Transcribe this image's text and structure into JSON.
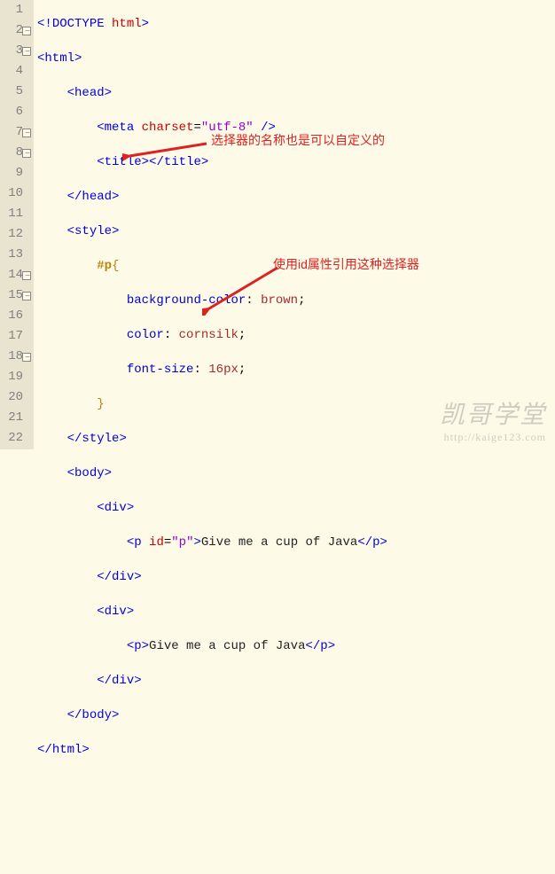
{
  "watermark": {
    "text": "凯哥学堂",
    "url": "http://kaige123.com"
  },
  "annotations": {
    "top": "选择器的名称也是可以自定义的",
    "bottom": "使用id属性引用这种选择器"
  },
  "gutter": [
    "1",
    "2",
    "3",
    "4",
    "5",
    "6",
    "7",
    "8",
    "9",
    "10",
    "11",
    "12",
    "13",
    "14",
    "15",
    "16",
    "17",
    "18",
    "19",
    "20",
    "21",
    "22"
  ],
  "code": {
    "l1": {
      "t1": "<!",
      "t2": "DOCTYPE",
      "sp": " ",
      "t3": "html",
      "t4": ">"
    },
    "l2": {
      "t1": "<",
      "t2": "html",
      "t3": ">"
    },
    "l3": {
      "pad": "    ",
      "t1": "<",
      "t2": "head",
      "t3": ">"
    },
    "l4": {
      "pad": "        ",
      "t1": "<",
      "t2": "meta",
      "sp": " ",
      "a1": "charset",
      "eq": "=",
      "q": "\"",
      "v1": "utf-8",
      "t3": " />"
    },
    "l5": {
      "pad": "        ",
      "t1": "<",
      "t2": "title",
      "t3": "></",
      "t4": "title",
      "t5": ">"
    },
    "l6": {
      "pad": "    ",
      "t1": "</",
      "t2": "head",
      "t3": ">"
    },
    "l7": {
      "pad": "    ",
      "t1": "<",
      "t2": "style",
      "t3": ">"
    },
    "l8": {
      "pad": "        ",
      "sel": "#p",
      "br": "{"
    },
    "l9": {
      "pad": "            ",
      "p": "background-color",
      "c": ": ",
      "v": "brown",
      "s": ";"
    },
    "l10": {
      "pad": "            ",
      "p": "color",
      "c": ": ",
      "v": "cornsilk",
      "s": ";"
    },
    "l11": {
      "pad": "            ",
      "p": "font-size",
      "c": ": ",
      "v": "16px",
      "s": ";"
    },
    "l12": {
      "pad": "        ",
      "br": "}"
    },
    "l13": {
      "pad": "    ",
      "t1": "</",
      "t2": "style",
      "t3": ">"
    },
    "l14": {
      "pad": "    ",
      "t1": "<",
      "t2": "body",
      "t3": ">"
    },
    "l15": {
      "pad": "        ",
      "t1": "<",
      "t2": "div",
      "t3": ">"
    },
    "l16": {
      "pad": "            ",
      "t1": "<",
      "t2": "p",
      "sp": " ",
      "a1": "id",
      "eq": "=",
      "q": "\"",
      "v1": "p",
      "t3": ">",
      "txt": "Give me a cup of Java",
      "t4": "</",
      "t5": "p",
      "t6": ">"
    },
    "l17": {
      "pad": "        ",
      "t1": "</",
      "t2": "div",
      "t3": ">"
    },
    "l18": {
      "pad": "        ",
      "t1": "<",
      "t2": "div",
      "t3": ">"
    },
    "l19": {
      "pad": "            ",
      "t1": "<",
      "t2": "p",
      "t3": ">",
      "txt": "Give me a cup of Java",
      "t4": "</",
      "t5": "p",
      "t6": ">"
    },
    "l20": {
      "pad": "        ",
      "t1": "</",
      "t2": "div",
      "t3": ">"
    },
    "l21": {
      "pad": "    ",
      "t1": "</",
      "t2": "body",
      "t3": ">"
    },
    "l22": {
      "t1": "</",
      "t2": "html",
      "t3": ">"
    }
  }
}
